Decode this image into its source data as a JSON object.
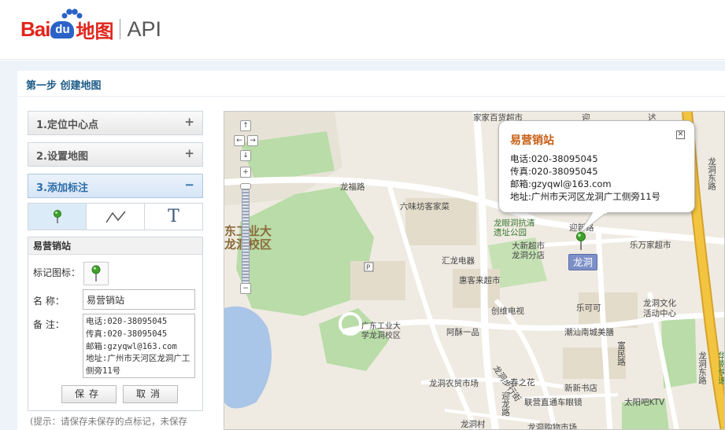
{
  "header": {
    "logo_bai": "Bai",
    "logo_du": "du",
    "logo_ditu": "地图",
    "logo_api": "API"
  },
  "step_title": "第一步  创建地图",
  "accordion": [
    {
      "label": "1.定位中心点",
      "sign": "+"
    },
    {
      "label": "2.设置地图",
      "sign": "+"
    },
    {
      "label": "3.添加标注",
      "sign": "−"
    }
  ],
  "tools": [
    {
      "icon": "marker-icon"
    },
    {
      "icon": "polyline-icon"
    },
    {
      "icon": "text-icon",
      "glyph": "T"
    }
  ],
  "form": {
    "header": "易营销站",
    "icon_label": "标记图标：",
    "name_label": "名  称：",
    "name_value": "易营销站",
    "note_label": "备  注：",
    "note_value": "电话:020-38095045\n传真:020-38095045\n邮箱:gzyqwl@163.com\n地址:广州市天河区龙洞广工侧旁11号",
    "save_label": "保存",
    "cancel_label": "取消"
  },
  "tip": "(提示：请保存未保存的点标记，未保存",
  "map": {
    "nav": {
      "up": "↑",
      "left": "←",
      "right": "→",
      "down": "↓",
      "zoom_in": "+",
      "zoom_out": "−"
    },
    "popup": {
      "title": "易营销站",
      "close": "✕",
      "phone": "电话:020-38095045",
      "fax": "传真:020-38095045",
      "email": "邮箱:gzyqwl@163.com",
      "address": "地址:广州市天河区龙洞广工侧旁11号"
    },
    "district_label": "龙洞",
    "labels": {
      "campus_big_1": "东工业大",
      "campus_big_2": "龙洞校区",
      "longfu_road": "龙福路",
      "liuweifang": "六味坊客家菜",
      "jiajia": "家家百货超市",
      "longyan_1": "龙眼洞抗清",
      "longyan_2": "遗址公园",
      "yingxin": "迎新路",
      "daxin_1": "大新超市",
      "daxin_2": "龙洞分店",
      "lewanjia": "乐万家超市",
      "huilong": "汇龙电器",
      "huikelai": "惠客来超市",
      "chuangwei": "创维电视",
      "gd_campus_1": "广东工业大",
      "gd_campus_2": "学龙洞校区",
      "akeke": "乐可可",
      "lcc_1": "龙洞文化",
      "lcc_2": "活动中心",
      "asu": "阿酥一品",
      "chaoshan": "潮汕南城美膳",
      "fuming": "富民路",
      "longdong_street": "龙洞步行街",
      "nongmao": "龙洞农贸市场",
      "chunzhihua": "春之花",
      "xinxin": "新新书店",
      "lianying": "联营直通车眼镜",
      "taiyangba": "太阳吧KTV",
      "longdong_village": "龙洞村",
      "yinglong": "迎龙路",
      "longdong_east_1": "龙洞东路",
      "longdong_east_2": "龙洞东路",
      "huanan": "华南快速",
      "tiny_1": "迎",
      "tiny_2": "迖",
      "bottom_cut": "龙洞购物市场"
    }
  },
  "colors": {
    "brand_red": "#e1251b",
    "brand_blue": "#2b62c8",
    "step_title": "#1d5b87",
    "popup_title": "#c75d12",
    "park_green": "#b9dca8",
    "water_blue": "#a9c5e8",
    "expressway": "#f2c440"
  }
}
